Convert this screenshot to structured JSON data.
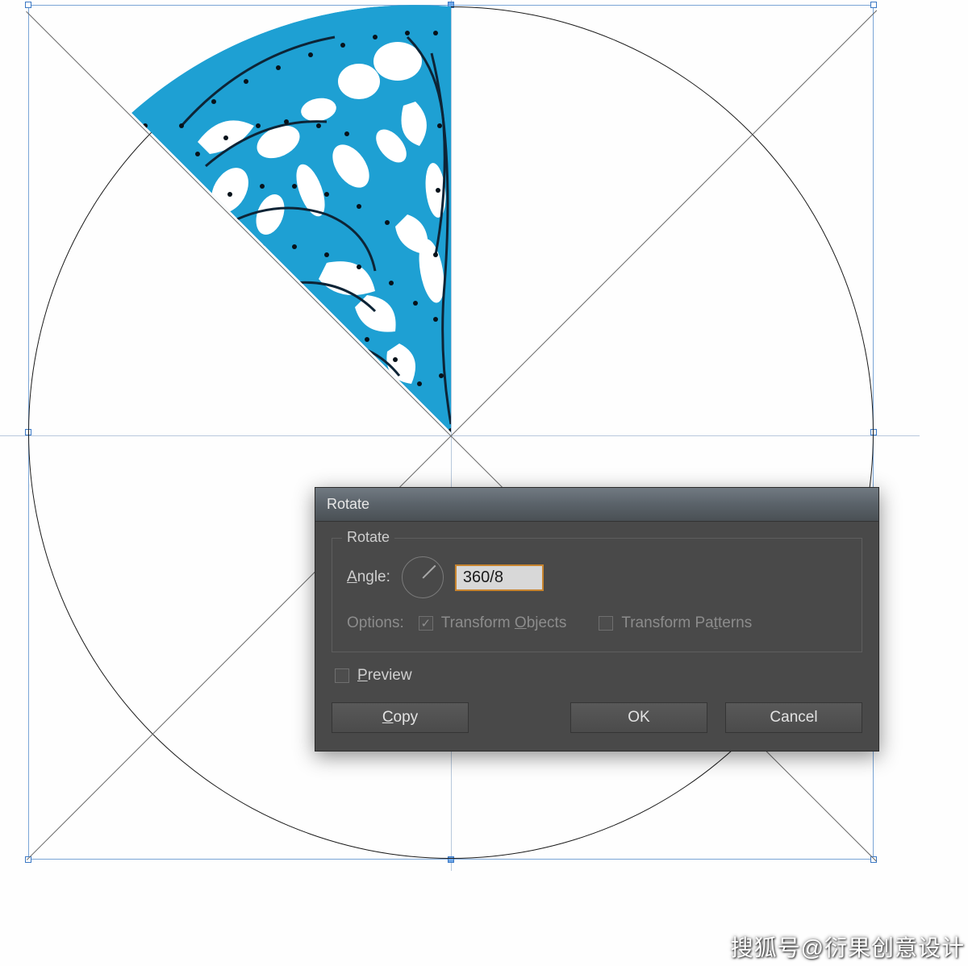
{
  "canvas": {
    "artwork_fill": "#1ea0d3",
    "artwork_stroke": "#0d2a3a",
    "bbox_stroke": "#7aa5d6",
    "circle_stroke": "#1a1a1a"
  },
  "dialog": {
    "title": "Rotate",
    "fieldset_legend": "Rotate",
    "angle_label_prefix": "A",
    "angle_label_rest": "ngle:",
    "angle_value": "360/8",
    "options_label": "Options:",
    "transform_objects_prefix": "Transform ",
    "transform_objects_ul": "O",
    "transform_objects_rest": "bjects",
    "transform_objects_checked": true,
    "transform_patterns_prefix": "Transform Pa",
    "transform_patterns_ul": "t",
    "transform_patterns_rest": "terns",
    "transform_patterns_checked": false,
    "preview_ul": "P",
    "preview_rest": "review",
    "preview_checked": false,
    "copy_ul": "C",
    "copy_rest": "opy",
    "ok_label": "OK",
    "cancel_label": "Cancel"
  },
  "watermark": "搜狐号@衍果创意设计"
}
